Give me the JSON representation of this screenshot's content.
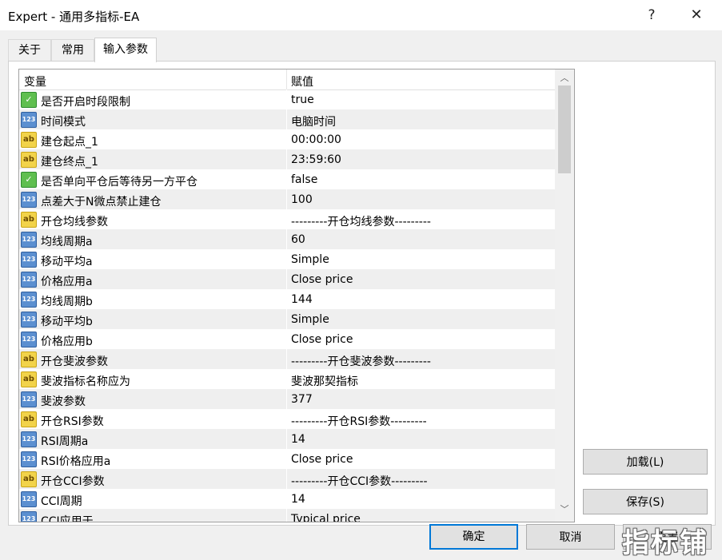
{
  "window": {
    "title": "Expert - 通用多指标-EA",
    "help_label": "?",
    "close_label": "✕"
  },
  "tabs": [
    {
      "label": "关于"
    },
    {
      "label": "常用"
    },
    {
      "label": "输入参数"
    }
  ],
  "grid": {
    "col_variable": "变量",
    "col_value": "赋值",
    "rows": [
      {
        "type": "bool",
        "name": "是否开启时段限制",
        "value": "true"
      },
      {
        "type": "num",
        "name": "时间模式",
        "value": "电脑时间"
      },
      {
        "type": "str",
        "name": "建仓起点_1",
        "value": "00:00:00"
      },
      {
        "type": "str",
        "name": "建仓终点_1",
        "value": "23:59:60"
      },
      {
        "type": "bool",
        "name": "是否单向平仓后等待另一方平仓",
        "value": "false"
      },
      {
        "type": "num",
        "name": "点差大于N微点禁止建仓",
        "value": "100"
      },
      {
        "type": "str",
        "name": "开仓均线参数",
        "value": "---------开仓均线参数---------"
      },
      {
        "type": "num",
        "name": "均线周期a",
        "value": "60"
      },
      {
        "type": "num",
        "name": "移动平均a",
        "value": "Simple"
      },
      {
        "type": "num",
        "name": "价格应用a",
        "value": "Close price"
      },
      {
        "type": "num",
        "name": "均线周期b",
        "value": "144"
      },
      {
        "type": "num",
        "name": "移动平均b",
        "value": "Simple"
      },
      {
        "type": "num",
        "name": "价格应用b",
        "value": "Close price"
      },
      {
        "type": "str",
        "name": "开仓斐波参数",
        "value": "---------开仓斐波参数---------"
      },
      {
        "type": "str",
        "name": "斐波指标名称应为",
        "value": "斐波那契指标"
      },
      {
        "type": "num",
        "name": "斐波参数",
        "value": "377"
      },
      {
        "type": "str",
        "name": "开仓RSI参数",
        "value": "---------开仓RSI参数---------"
      },
      {
        "type": "num",
        "name": "RSI周期a",
        "value": "14"
      },
      {
        "type": "num",
        "name": "RSI价格应用a",
        "value": "Close price"
      },
      {
        "type": "str",
        "name": "开仓CCI参数",
        "value": "---------开仓CCI参数---------"
      },
      {
        "type": "num",
        "name": "CCI周期",
        "value": "14"
      },
      {
        "type": "num",
        "name": "CCI应用于",
        "value": "Typical price"
      }
    ]
  },
  "icons": {
    "bool": "bool-icon",
    "num": "integer-icon",
    "str": "string-icon",
    "bool_glyph": "✓",
    "num_glyph": "123",
    "str_glyph": "ab"
  },
  "buttons": {
    "load": "加载(L)",
    "save": "保存(S)",
    "ok": "确定",
    "cancel": "取消",
    "reset": "重置"
  },
  "watermark": "指标铺"
}
